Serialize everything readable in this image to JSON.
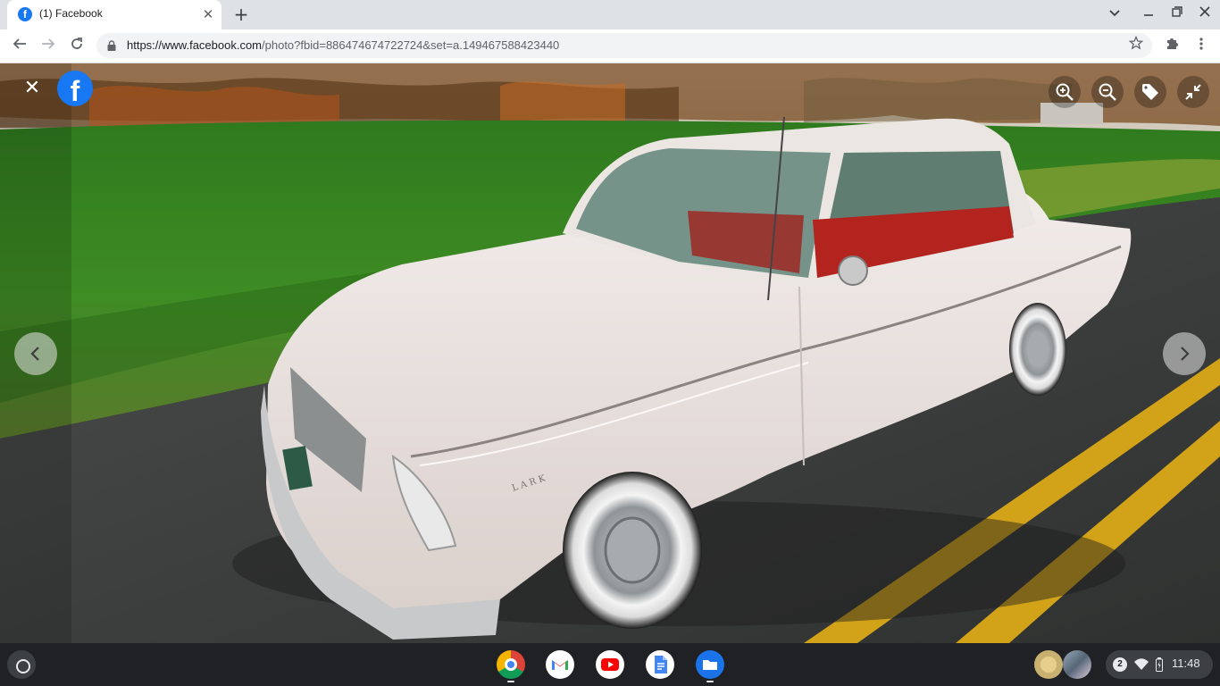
{
  "browser": {
    "tab": {
      "favicon": "f",
      "title": "(1) Facebook",
      "close": "✕"
    },
    "new_tab": "+",
    "url_host": "https://www.facebook.com",
    "url_path": "/photo?fbid=886474674722724&set=a.149467588423440",
    "icons": [
      "back-arrow-icon",
      "forward-arrow-icon",
      "reload-icon",
      "lock-icon",
      "star-icon",
      "extensions-icon",
      "menu-icon",
      "tab-search-icon",
      "minimize-icon",
      "restore-icon",
      "close-icon"
    ]
  },
  "viewer": {
    "close": "✕",
    "logo": "f",
    "tools": [
      "zoom-in-icon",
      "zoom-out-icon",
      "tag-icon",
      "exit-fullscreen-icon"
    ],
    "photo_badge_text": "L A R K"
  },
  "shelf": {
    "apps": [
      "chrome",
      "gmail",
      "youtube",
      "docs",
      "files"
    ],
    "notification_count": "2",
    "time": "11:48"
  },
  "colors": {
    "facebook_blue": "#1877f2",
    "shelf_bg": "#202124",
    "tabstrip_bg": "#dee1e6"
  }
}
